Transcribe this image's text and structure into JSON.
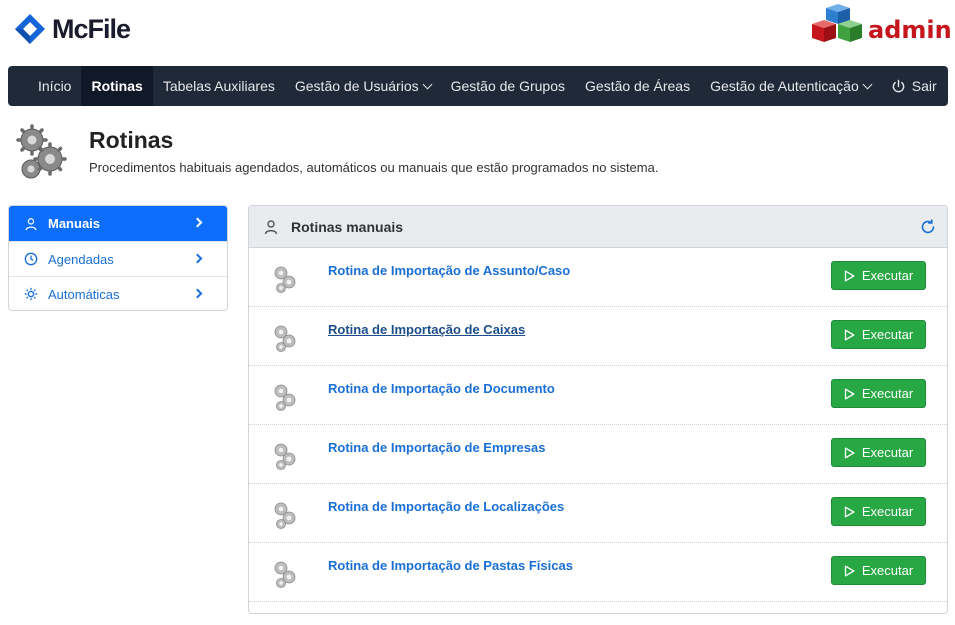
{
  "brand": {
    "name": "McFile",
    "admin_label": "admin"
  },
  "nav": {
    "items": [
      {
        "label": "Início",
        "active": false,
        "dropdown": false
      },
      {
        "label": "Rotinas",
        "active": true,
        "dropdown": false
      },
      {
        "label": "Tabelas Auxiliares",
        "active": false,
        "dropdown": false
      },
      {
        "label": "Gestão de Usuários",
        "active": false,
        "dropdown": true
      },
      {
        "label": "Gestão de Grupos",
        "active": false,
        "dropdown": false
      },
      {
        "label": "Gestão de Áreas",
        "active": false,
        "dropdown": false
      },
      {
        "label": "Gestão de Autenticação",
        "active": false,
        "dropdown": true
      }
    ],
    "logout_label": "Sair",
    "logout_icon": "power-icon"
  },
  "page": {
    "title": "Rotinas",
    "subtitle": "Procedimentos habituais agendados, automáticos ou manuais que estão programados no sistema.",
    "icon": "gears-icon"
  },
  "sidebar": {
    "items": [
      {
        "label": "Manuais",
        "icon": "user-icon",
        "active": true
      },
      {
        "label": "Agendadas",
        "icon": "clock-icon",
        "active": false
      },
      {
        "label": "Automáticas",
        "icon": "gear-icon",
        "active": false
      }
    ]
  },
  "panel": {
    "title": "Rotinas manuais",
    "icon": "user-icon",
    "refresh_icon": "refresh-icon",
    "button_label": "Executar",
    "rows": [
      {
        "label": "Rotina de Importação de Assunto/Caso",
        "hover": false
      },
      {
        "label": "Rotina de Importação de Caixas",
        "hover": true
      },
      {
        "label": "Rotina de Importação de Documento",
        "hover": false
      },
      {
        "label": "Rotina de Importação de Empresas",
        "hover": false
      },
      {
        "label": "Rotina de Importação de Localizações",
        "hover": false
      },
      {
        "label": "Rotina de Importação de Pastas Físicas",
        "hover": false
      }
    ]
  },
  "colors": {
    "navbar": "#1f2937",
    "primary": "#0d6efd",
    "link": "#1a6fd6",
    "success": "#28a745",
    "admin_red": "#c4161c"
  }
}
